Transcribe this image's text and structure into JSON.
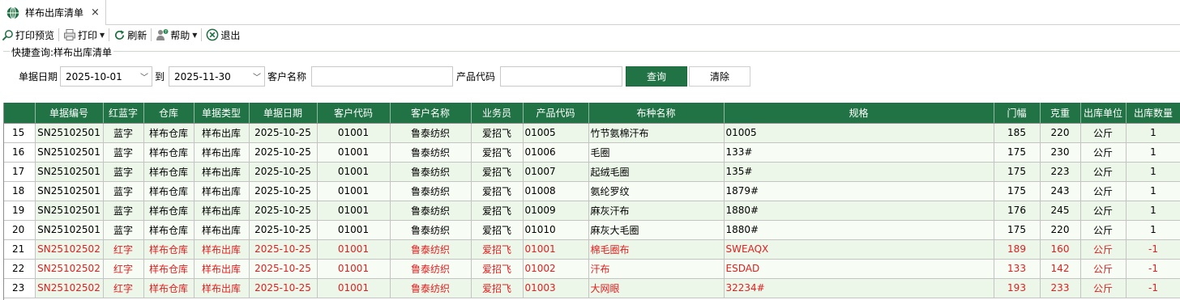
{
  "tab": {
    "title": "样布出库清单",
    "close": "×",
    "icon": "globe-icon"
  },
  "toolbar": {
    "print_preview": "打印预览",
    "print": "打印",
    "refresh": "刷新",
    "help": "帮助",
    "exit": "退出"
  },
  "query": {
    "title": "快捷查询:样布出库清单",
    "date_label": "单据日期",
    "date_from": "2025-10-01",
    "to_label": "到",
    "date_to": "2025-11-30",
    "customer_label": "客户名称",
    "customer_value": "",
    "product_label": "产品代码",
    "product_value": "",
    "search_button": "查询",
    "clear_button": "清除"
  },
  "table": {
    "columns": [
      "",
      "单据编号",
      "红蓝字",
      "仓库",
      "单据类型",
      "单据日期",
      "客户代码",
      "客户名称",
      "业务员",
      "产品代码",
      "布种名称",
      "规格",
      "门幅",
      "克重",
      "出库单位",
      "出库数量"
    ],
    "rows": [
      {
        "type": "blue",
        "cells": [
          "15",
          "SN25102501",
          "蓝字",
          "样布仓库",
          "样布出库",
          "2025-10-25",
          "01001",
          "鲁泰纺织",
          "爱招飞",
          "01005",
          "竹节氨棉汗布",
          "01005",
          "185",
          "220",
          "公斤",
          "1"
        ]
      },
      {
        "type": "blue",
        "cells": [
          "16",
          "SN25102501",
          "蓝字",
          "样布仓库",
          "样布出库",
          "2025-10-25",
          "01001",
          "鲁泰纺织",
          "爱招飞",
          "01006",
          "毛圈",
          "133#",
          "175",
          "230",
          "公斤",
          "1"
        ]
      },
      {
        "type": "blue",
        "cells": [
          "17",
          "SN25102501",
          "蓝字",
          "样布仓库",
          "样布出库",
          "2025-10-25",
          "01001",
          "鲁泰纺织",
          "爱招飞",
          "01007",
          "起绒毛圈",
          "135#",
          "175",
          "223",
          "公斤",
          "1"
        ]
      },
      {
        "type": "blue",
        "cells": [
          "18",
          "SN25102501",
          "蓝字",
          "样布仓库",
          "样布出库",
          "2025-10-25",
          "01001",
          "鲁泰纺织",
          "爱招飞",
          "01008",
          "氨纶罗纹",
          "1879#",
          "175",
          "243",
          "公斤",
          "1"
        ]
      },
      {
        "type": "blue",
        "cells": [
          "19",
          "SN25102501",
          "蓝字",
          "样布仓库",
          "样布出库",
          "2025-10-25",
          "01001",
          "鲁泰纺织",
          "爱招飞",
          "01009",
          "麻灰汗布",
          "1880#",
          "176",
          "245",
          "公斤",
          "1"
        ]
      },
      {
        "type": "blue",
        "cells": [
          "20",
          "SN25102501",
          "蓝字",
          "样布仓库",
          "样布出库",
          "2025-10-25",
          "01001",
          "鲁泰纺织",
          "爱招飞",
          "01010",
          "麻灰大毛圈",
          "1880#",
          "175",
          "220",
          "公斤",
          "1"
        ]
      },
      {
        "type": "red",
        "cells": [
          "21",
          "SN25102502",
          "红字",
          "样布仓库",
          "样布出库",
          "2025-10-25",
          "01001",
          "鲁泰纺织",
          "爱招飞",
          "01001",
          "棉毛圈布",
          "SWEAQX",
          "189",
          "160",
          "公斤",
          "-1"
        ]
      },
      {
        "type": "red",
        "cells": [
          "22",
          "SN25102502",
          "红字",
          "样布仓库",
          "样布出库",
          "2025-10-25",
          "01001",
          "鲁泰纺织",
          "爱招飞",
          "01002",
          "汗布",
          "ESDAD",
          "133",
          "142",
          "公斤",
          "-1"
        ]
      },
      {
        "type": "red",
        "cells": [
          "23",
          "SN25102502",
          "红字",
          "样布仓库",
          "样布出库",
          "2025-10-25",
          "01001",
          "鲁泰纺织",
          "爱招飞",
          "01003",
          "大网眼",
          "32234#",
          "193",
          "233",
          "公斤",
          "-1"
        ]
      }
    ]
  },
  "colors": {
    "accent": "#217346",
    "red_text": "#e02020",
    "row_odd": "#ecf6e9",
    "row_even": "#f7fcf5"
  }
}
